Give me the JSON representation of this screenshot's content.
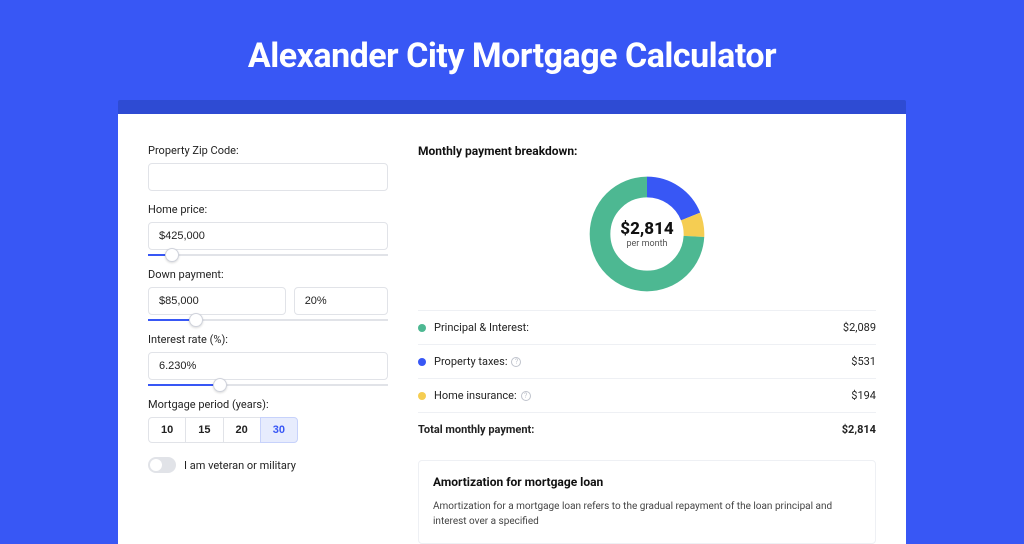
{
  "page": {
    "title": "Alexander City Mortgage Calculator"
  },
  "form": {
    "zip": {
      "label": "Property Zip Code:",
      "value": ""
    },
    "home_price": {
      "label": "Home price:",
      "value": "$425,000",
      "slider_pct": 10
    },
    "down_payment": {
      "label": "Down payment:",
      "amount": "$85,000",
      "percent": "20%",
      "slider_pct": 20
    },
    "interest": {
      "label": "Interest rate (%):",
      "value": "6.230%",
      "slider_pct": 30
    },
    "period": {
      "label": "Mortgage period (years):",
      "options": [
        "10",
        "15",
        "20",
        "30"
      ],
      "selected": "30"
    },
    "veteran": {
      "label": "I am veteran or military",
      "on": false
    }
  },
  "breakdown": {
    "title": "Monthly payment breakdown:",
    "center_amount": "$2,814",
    "center_label": "per month",
    "items": [
      {
        "name": "Principal & Interest:",
        "value": "$2,089",
        "color": "#4db892",
        "info": false,
        "fraction": 0.742
      },
      {
        "name": "Property taxes:",
        "value": "$531",
        "color": "#3857f5",
        "info": true,
        "fraction": 0.189
      },
      {
        "name": "Home insurance:",
        "value": "$194",
        "color": "#f5cd52",
        "info": true,
        "fraction": 0.069
      }
    ],
    "total": {
      "name": "Total monthly payment:",
      "value": "$2,814"
    }
  },
  "amortization": {
    "title": "Amortization for mortgage loan",
    "body": "Amortization for a mortgage loan refers to the gradual repayment of the loan principal and interest over a specified"
  }
}
